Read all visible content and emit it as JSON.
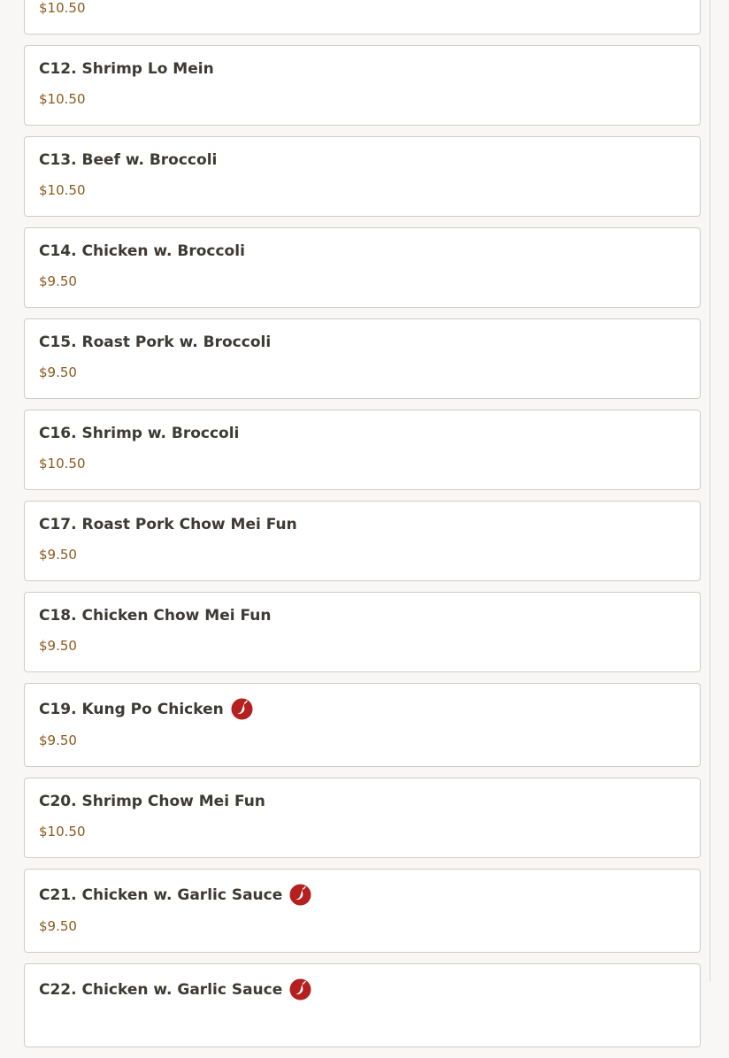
{
  "items": [
    {
      "name": "",
      "price": "$10.50",
      "spicy": false
    },
    {
      "name": "C12. Shrimp Lo Mein",
      "price": "$10.50",
      "spicy": false
    },
    {
      "name": "C13. Beef w. Broccoli",
      "price": "$10.50",
      "spicy": false
    },
    {
      "name": "C14. Chicken w. Broccoli",
      "price": "$9.50",
      "spicy": false
    },
    {
      "name": "C15. Roast Pork w. Broccoli",
      "price": "$9.50",
      "spicy": false
    },
    {
      "name": "C16. Shrimp w. Broccoli",
      "price": "$10.50",
      "spicy": false
    },
    {
      "name": "C17. Roast Pork Chow Mei Fun",
      "price": "$9.50",
      "spicy": false
    },
    {
      "name": "C18. Chicken Chow Mei Fun",
      "price": "$9.50",
      "spicy": false
    },
    {
      "name": "C19. Kung Po Chicken",
      "price": "$9.50",
      "spicy": true
    },
    {
      "name": "C20. Shrimp Chow Mei Fun",
      "price": "$10.50",
      "spicy": false
    },
    {
      "name": "C21. Chicken w. Garlic Sauce",
      "price": "$9.50",
      "spicy": true
    },
    {
      "name": "C22. Chicken w. Garlic Sauce",
      "price": "",
      "spicy": true
    }
  ],
  "colors": {
    "spicy_icon": "#b3201f",
    "price": "#8a5a1e",
    "name": "#3d3935"
  },
  "icons": {
    "spicy": "chili-pepper-icon"
  }
}
